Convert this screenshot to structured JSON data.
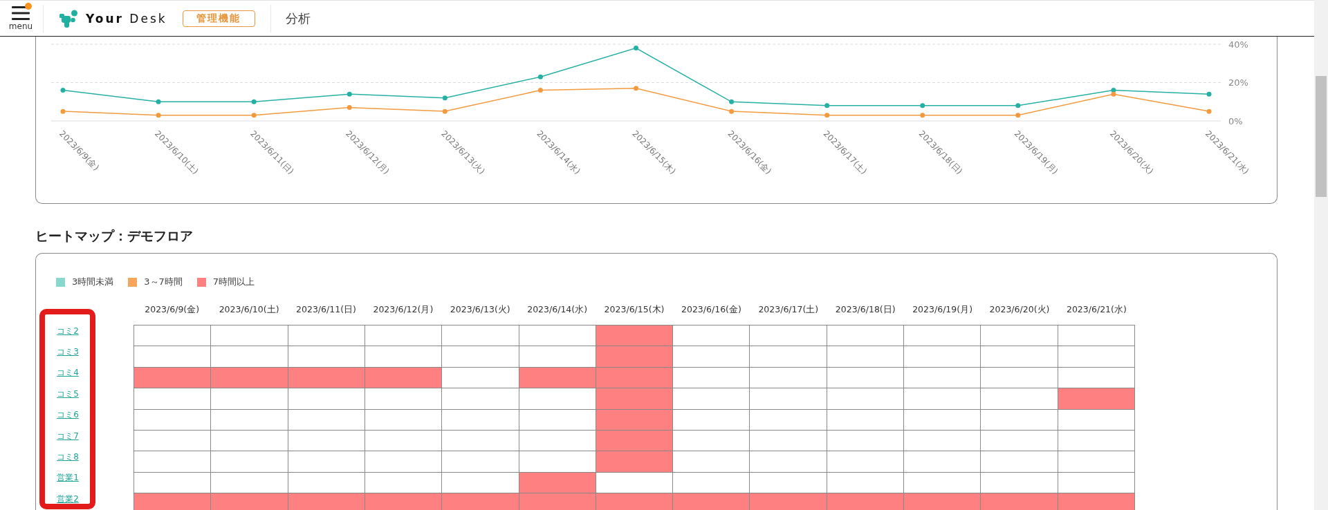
{
  "header": {
    "menu_label": "menu",
    "logo_text": "**Your** Desk",
    "badge": "管理機能",
    "page_title": "分析"
  },
  "trend_chart": {
    "chart_data": {
      "type": "line",
      "x": [
        "2023/6/9(金)",
        "2023/6/10(土)",
        "2023/6/11(日)",
        "2023/6/12(月)",
        "2023/6/13(火)",
        "2023/6/14(水)",
        "2023/6/15(木)",
        "2023/6/16(金)",
        "2023/6/17(土)",
        "2023/6/18(日)",
        "2023/6/19(月)",
        "2023/6/20(火)",
        "2023/6/21(水)"
      ],
      "series": [
        {
          "color": "#26b0a3",
          "marker": "circle",
          "values": [
            16,
            10,
            10,
            14,
            12,
            23,
            38,
            10,
            8,
            8,
            8,
            16,
            14
          ]
        },
        {
          "color": "#f39a3e",
          "marker": "circle",
          "values": [
            5,
            3,
            3,
            7,
            5,
            16,
            17,
            5,
            3,
            3,
            3,
            14,
            5
          ]
        }
      ],
      "ylim": [
        0,
        40
      ],
      "yticks": [
        {
          "value": 0,
          "label": "0%"
        },
        {
          "value": 20,
          "label": "20%"
        },
        {
          "value": 40,
          "label": "40%"
        }
      ]
    }
  },
  "heatmap": {
    "title": "ヒートマップ：デモフロア",
    "legend": [
      {
        "label": "3時間未満",
        "color": "#88d8d0"
      },
      {
        "label": "3～7時間",
        "color": "#f8a55c"
      },
      {
        "label": "7時間以上",
        "color": "#ff8080"
      }
    ],
    "columns": [
      "2023/6/9(金)",
      "2023/6/10(土)",
      "2023/6/11(日)",
      "2023/6/12(月)",
      "2023/6/13(火)",
      "2023/6/14(水)",
      "2023/6/15(木)",
      "2023/6/16(金)",
      "2023/6/17(土)",
      "2023/6/18(日)",
      "2023/6/19(月)",
      "2023/6/20(火)",
      "2023/6/21(水)"
    ],
    "rows": [
      {
        "label": "コミ2",
        "cells": [
          {
            "color": "#ffffff"
          },
          {
            "color": "#ffffff"
          },
          {
            "color": "#ffffff"
          },
          {
            "color": "#ffffff"
          },
          {
            "color": "#ffffff"
          },
          {
            "color": "#ffffff"
          },
          {
            "color": "#ff8080"
          },
          {
            "color": "#ffffff"
          },
          {
            "color": "#ffffff"
          },
          {
            "color": "#ffffff"
          },
          {
            "color": "#ffffff"
          },
          {
            "color": "#ffffff"
          },
          {
            "color": "#ffffff"
          }
        ]
      },
      {
        "label": "コミ3",
        "cells": [
          {
            "color": "#ffffff"
          },
          {
            "color": "#ffffff"
          },
          {
            "color": "#ffffff"
          },
          {
            "color": "#ffffff"
          },
          {
            "color": "#ffffff"
          },
          {
            "color": "#ffffff"
          },
          {
            "color": "#ff8080"
          },
          {
            "color": "#ffffff"
          },
          {
            "color": "#ffffff"
          },
          {
            "color": "#ffffff"
          },
          {
            "color": "#ffffff"
          },
          {
            "color": "#ffffff"
          },
          {
            "color": "#ffffff"
          }
        ]
      },
      {
        "label": "コミ4",
        "cells": [
          {
            "color": "#ff8080"
          },
          {
            "color": "#ff8080"
          },
          {
            "color": "#ff8080"
          },
          {
            "color": "#ff8080"
          },
          {
            "color": "#ffffff"
          },
          {
            "color": "#ff8080"
          },
          {
            "color": "#ff8080"
          },
          {
            "color": "#ffffff"
          },
          {
            "color": "#ffffff"
          },
          {
            "color": "#ffffff"
          },
          {
            "color": "#ffffff"
          },
          {
            "color": "#ffffff"
          },
          {
            "color": "#ffffff"
          }
        ]
      },
      {
        "label": "コミ5",
        "cells": [
          {
            "color": "#ffffff"
          },
          {
            "color": "#ffffff"
          },
          {
            "color": "#ffffff"
          },
          {
            "color": "#ffffff"
          },
          {
            "color": "#ffffff"
          },
          {
            "color": "#ffffff"
          },
          {
            "color": "#ff8080"
          },
          {
            "color": "#ffffff"
          },
          {
            "color": "#ffffff"
          },
          {
            "color": "#ffffff"
          },
          {
            "color": "#ffffff"
          },
          {
            "color": "#ffffff"
          },
          {
            "color": "#ff8080"
          }
        ]
      },
      {
        "label": "コミ6",
        "cells": [
          {
            "color": "#ffffff"
          },
          {
            "color": "#ffffff"
          },
          {
            "color": "#ffffff"
          },
          {
            "color": "#ffffff"
          },
          {
            "color": "#ffffff"
          },
          {
            "color": "#ffffff"
          },
          {
            "color": "#ff8080"
          },
          {
            "color": "#ffffff"
          },
          {
            "color": "#ffffff"
          },
          {
            "color": "#ffffff"
          },
          {
            "color": "#ffffff"
          },
          {
            "color": "#ffffff"
          },
          {
            "color": "#ffffff"
          }
        ]
      },
      {
        "label": "コミ7",
        "cells": [
          {
            "color": "#ffffff"
          },
          {
            "color": "#ffffff"
          },
          {
            "color": "#ffffff"
          },
          {
            "color": "#ffffff"
          },
          {
            "color": "#ffffff"
          },
          {
            "color": "#ffffff"
          },
          {
            "color": "#ff8080"
          },
          {
            "color": "#ffffff"
          },
          {
            "color": "#ffffff"
          },
          {
            "color": "#ffffff"
          },
          {
            "color": "#ffffff"
          },
          {
            "color": "#ffffff"
          },
          {
            "color": "#ffffff"
          }
        ]
      },
      {
        "label": "コミ8",
        "cells": [
          {
            "color": "#ffffff"
          },
          {
            "color": "#ffffff"
          },
          {
            "color": "#ffffff"
          },
          {
            "color": "#ffffff"
          },
          {
            "color": "#ffffff"
          },
          {
            "color": "#ffffff"
          },
          {
            "color": "#ff8080"
          },
          {
            "color": "#ffffff"
          },
          {
            "color": "#ffffff"
          },
          {
            "color": "#ffffff"
          },
          {
            "color": "#ffffff"
          },
          {
            "color": "#ffffff"
          },
          {
            "color": "#ffffff"
          }
        ]
      },
      {
        "label": "営業1",
        "cells": [
          {
            "color": "#ffffff"
          },
          {
            "color": "#ffffff"
          },
          {
            "color": "#ffffff"
          },
          {
            "color": "#ffffff"
          },
          {
            "color": "#ffffff"
          },
          {
            "color": "#ff8080"
          },
          {
            "color": "#ffffff"
          },
          {
            "color": "#ffffff"
          },
          {
            "color": "#ffffff"
          },
          {
            "color": "#ffffff"
          },
          {
            "color": "#ffffff"
          },
          {
            "color": "#ffffff"
          },
          {
            "color": "#ffffff"
          }
        ]
      },
      {
        "label": "営業2",
        "cells": [
          {
            "color": "#ff8080"
          },
          {
            "color": "#ff8080"
          },
          {
            "color": "#ff8080"
          },
          {
            "color": "#ff8080"
          },
          {
            "color": "#ff8080"
          },
          {
            "color": "#ff8080"
          },
          {
            "color": "#ff8080"
          },
          {
            "color": "#ff8080"
          },
          {
            "color": "#ff8080"
          },
          {
            "color": "#ff8080"
          },
          {
            "color": "#ff8080"
          },
          {
            "color": "#ff8080"
          },
          {
            "color": "#ff8080"
          }
        ]
      }
    ]
  }
}
